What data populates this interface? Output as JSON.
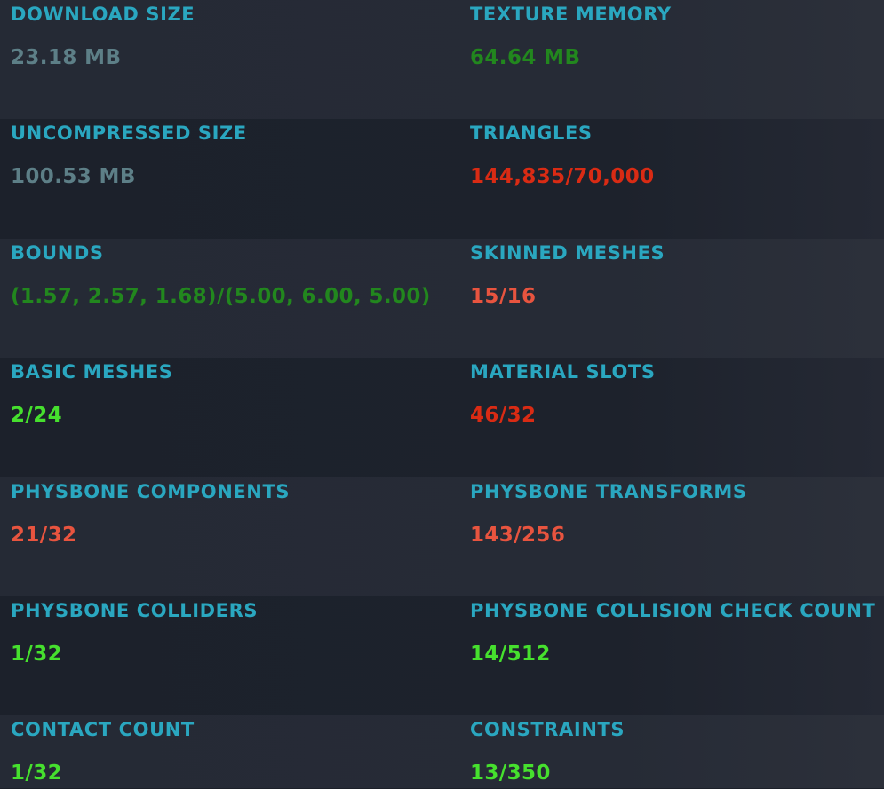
{
  "colors": {
    "label": "#2aa7c0",
    "neutral": "#5d7f87",
    "good": "#46e02e",
    "medium": "#22871e",
    "poor": "#e8543f",
    "very_poor": "#d92b14"
  },
  "rows": [
    {
      "left": {
        "label": "DOWNLOAD SIZE",
        "value": "23.18 MB",
        "color": "#5d7f87"
      },
      "right": {
        "label": "TEXTURE MEMORY",
        "value": "64.64 MB",
        "color": "#22871e"
      }
    },
    {
      "left": {
        "label": "UNCOMPRESSED SIZE",
        "value": "100.53 MB",
        "color": "#5d7f87"
      },
      "right": {
        "label": "TRIANGLES",
        "value": "144,835/70,000",
        "color": "#d92b14"
      }
    },
    {
      "left": {
        "label": "BOUNDS",
        "value": "(1.57, 2.57, 1.68)/(5.00, 6.00, 5.00)",
        "color": "#22871e"
      },
      "right": {
        "label": "SKINNED MESHES",
        "value": "15/16",
        "color": "#e8543f"
      }
    },
    {
      "left": {
        "label": "BASIC MESHES",
        "value": "2/24",
        "color": "#46e02e"
      },
      "right": {
        "label": "MATERIAL SLOTS",
        "value": "46/32",
        "color": "#d92b14"
      }
    },
    {
      "left": {
        "label": "PHYSBONE COMPONENTS",
        "value": "21/32",
        "color": "#e8543f"
      },
      "right": {
        "label": "PHYSBONE TRANSFORMS",
        "value": "143/256",
        "color": "#e8543f"
      }
    },
    {
      "left": {
        "label": "PHYSBONE COLLIDERS",
        "value": "1/32",
        "color": "#46e02e"
      },
      "right": {
        "label": "PHYSBONE COLLISION CHECK COUNT",
        "value": "14/512",
        "color": "#46e02e"
      }
    },
    {
      "left": {
        "label": "CONTACT COUNT",
        "value": "1/32",
        "color": "#46e02e"
      },
      "right": {
        "label": "CONSTRAINTS",
        "value": "13/350",
        "color": "#46e02e"
      }
    }
  ]
}
